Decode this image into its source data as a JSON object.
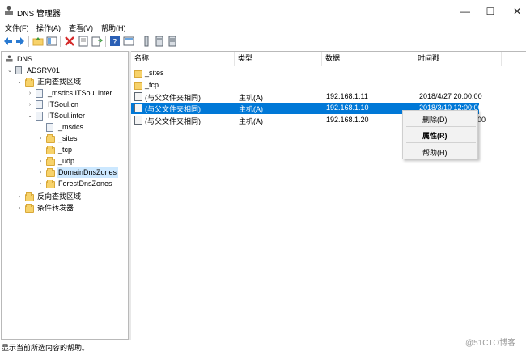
{
  "window": {
    "title": "DNS 管理器",
    "minimize_glyph": "—",
    "maximize_glyph": "☐",
    "close_glyph": "✕"
  },
  "menu": [
    "文件(F)",
    "操作(A)",
    "查看(V)",
    "帮助(H)"
  ],
  "toolbar": {
    "buttons": [
      "back-arrow-icon",
      "forward-arrow-icon",
      "up-folder-icon",
      "console-tree-icon",
      "delete-icon",
      "properties-icon",
      "export-list-icon",
      "help-icon",
      "pane-icon",
      "filter-icon",
      "server-a-icon",
      "server-b-icon"
    ],
    "colors": {
      "arrow": "#2a7ad1",
      "delete": "#d42a2a"
    }
  },
  "tree": {
    "items": [
      {
        "label": "DNS",
        "icon": "dns-icon",
        "expander": ""
      },
      {
        "label": "ADSRV01",
        "icon": "server-icon",
        "expander": "⌄"
      },
      {
        "label": "正向查找区域",
        "icon": "folder-icon",
        "expander": "⌄"
      },
      {
        "label": "_msdcs.ITSoul.inter",
        "icon": "zone-icon",
        "expander": "›"
      },
      {
        "label": "ITSoul.cn",
        "icon": "zone-icon",
        "expander": "›"
      },
      {
        "label": "ITSoul.inter",
        "icon": "zone-icon",
        "expander": "⌄"
      },
      {
        "label": "_msdcs",
        "icon": "zone-icon",
        "expander": ""
      },
      {
        "label": "_sites",
        "icon": "folder-icon",
        "expander": "›"
      },
      {
        "label": "_tcp",
        "icon": "folder-icon",
        "expander": ""
      },
      {
        "label": "_udp",
        "icon": "folder-icon",
        "expander": "›"
      },
      {
        "label": "DomainDnsZones",
        "icon": "folder-icon",
        "expander": "›",
        "selected": true
      },
      {
        "label": "ForestDnsZones",
        "icon": "folder-icon",
        "expander": "›"
      },
      {
        "label": "反向查找区域",
        "icon": "folder-icon",
        "expander": "›"
      },
      {
        "label": "条件转发器",
        "icon": "folder-icon",
        "expander": "›"
      }
    ]
  },
  "list": {
    "columns": [
      "名称",
      "类型",
      "数据",
      "时间戳"
    ],
    "rows": [
      {
        "name": "_sites",
        "type": "",
        "data": "",
        "timestamp": "",
        "icon": "folder-icon"
      },
      {
        "name": "_tcp",
        "type": "",
        "data": "",
        "timestamp": "",
        "icon": "folder-icon"
      },
      {
        "name": "(与父文件夹相同)",
        "type": "主机(A)",
        "data": "192.168.1.11",
        "timestamp": "2018/4/27 20:00:00",
        "icon": "host-record-icon"
      },
      {
        "name": "(与父文件夹相同)",
        "type": "主机(A)",
        "data": "192.168.1.10",
        "timestamp": "2018/3/10 12:00:00",
        "icon": "host-record-icon",
        "selected": true
      },
      {
        "name": "(与父文件夹相同)",
        "type": "主机(A)",
        "data": "192.168.1.20",
        "timestamp": "00",
        "icon": "host-record-icon"
      }
    ]
  },
  "context_menu": {
    "items": [
      "删除(D)",
      "属性(R)",
      "帮助(H)"
    ]
  },
  "status": {
    "text": "显示当前所选内容的帮助。"
  },
  "watermark": "@51CTO博客"
}
